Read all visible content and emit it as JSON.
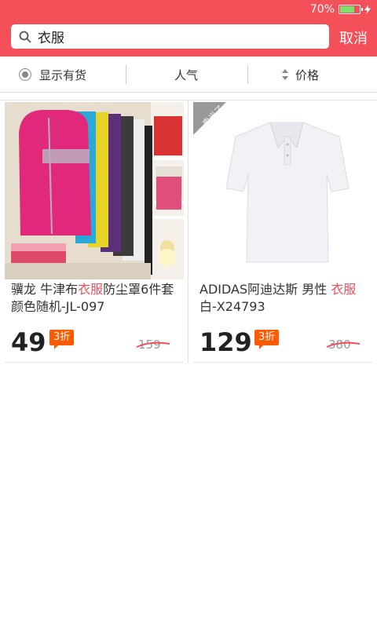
{
  "status_bar": {
    "battery": "70%",
    "battery_level": 0.7
  },
  "colors": {
    "brand": "#f4505a",
    "discount": "#ff5a00",
    "highlight": "#ef4f5c"
  },
  "search": {
    "query": "衣服",
    "cancel_label": "取消"
  },
  "filters": {
    "in_stock_label": "显示有货",
    "popularity_label": "人气",
    "price_label": "价格"
  },
  "products": [
    {
      "title_parts": [
        "骥龙 牛津布",
        "衣服",
        "防尘罩6件套颜色随机-JL-097"
      ],
      "price": "49",
      "discount": "3折",
      "original_price": "159",
      "sold_out": false
    },
    {
      "title_parts": [
        "ADIDAS阿迪达斯 男性 ",
        "衣服",
        "白-X24793"
      ],
      "price": "129",
      "discount": "3折",
      "original_price": "380",
      "sold_out": true,
      "sold_out_label": "卖光了"
    }
  ]
}
